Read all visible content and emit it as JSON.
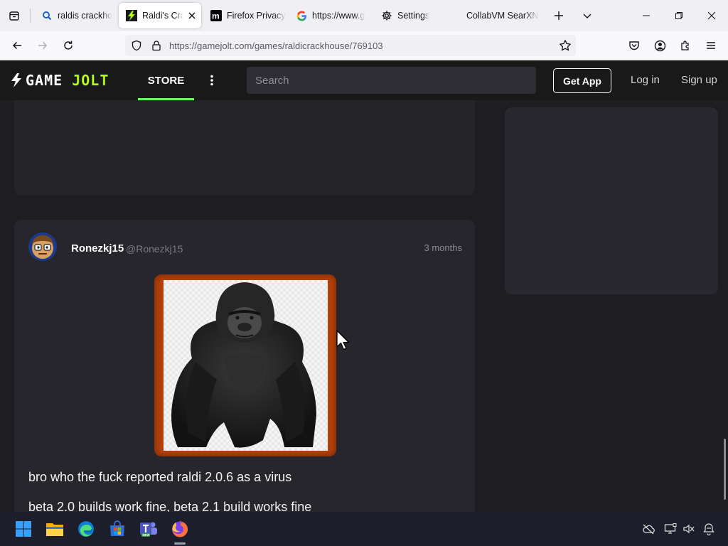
{
  "browser": {
    "tabs": [
      {
        "title": "raldis crackho",
        "icon": "search-icon",
        "active": false
      },
      {
        "title": "Raldi's Crac",
        "icon": "gamejolt-favicon",
        "active": true
      },
      {
        "title": "Firefox Privacy",
        "icon": "mozilla-favicon",
        "active": false
      },
      {
        "title": "https://www.g",
        "icon": "google-favicon",
        "active": false
      },
      {
        "title": "Settings",
        "icon": "gear-icon",
        "active": false
      },
      {
        "title": "CollabVM SearXNG",
        "icon": "",
        "active": false
      }
    ],
    "url": "https://gamejolt.com/games/raldicrackhouse/769103"
  },
  "site": {
    "logo": {
      "part1": "GAME",
      "part2": "JOLT"
    },
    "nav_store": "STORE",
    "search_placeholder": "Search",
    "get_app": "Get App",
    "login": "Log in",
    "signup": "Sign up"
  },
  "post": {
    "author": "Ronezkj15",
    "handle": "@Ronezkj15",
    "time": "3 months",
    "lines": [
      "bro who the fuck reported raldi 2.0.6 as a virus",
      "beta 2.0 builds work fine, beta 2.1 build works fine"
    ]
  },
  "colors": {
    "header_bg": "#191919",
    "page_bg": "#1d1d22",
    "card_bg": "#26262c",
    "accent_green": "#6bff6b",
    "image_frame": "#b5400a"
  },
  "taskbar": {
    "icons": [
      "windows-start-icon",
      "file-explorer-icon",
      "edge-icon",
      "store-icon",
      "teams-icon",
      "firefox-icon"
    ],
    "tray": [
      "cloud-off-icon",
      "network-icon",
      "volume-muted-icon",
      "notification-icon"
    ]
  }
}
